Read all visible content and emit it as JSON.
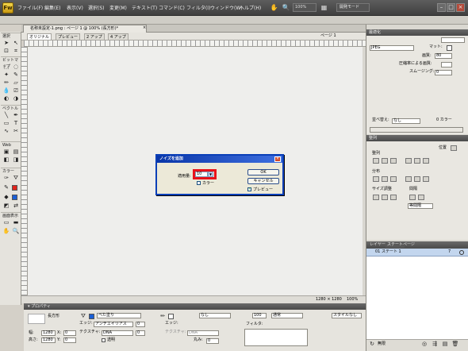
{
  "menubar": {
    "logo": "Fw",
    "items": [
      "ファイル(F)",
      "編集(E)",
      "表示(V)",
      "選択(S)",
      "変更(M)",
      "テキスト(T)",
      "コマンド(C)",
      "フィルタ(I)",
      "ウィンドウ(W)",
      "ヘルプ(H)"
    ],
    "zoom": "100%",
    "mode": "開発モード"
  },
  "document": {
    "title": "名称未設定-1.png : ページ 1 @ 100% (長方形)*",
    "views": [
      "オリジナル",
      "プレビュー",
      "2 アップ",
      "4 アップ"
    ],
    "page": "ページ 1",
    "status_size": "1280 × 1280",
    "status_zoom": "100%"
  },
  "tools": {
    "sections": [
      "選択",
      "ビットマップ",
      "ベクトル",
      "Web",
      "カラー",
      "画面表示"
    ],
    "colors": {
      "stroke": "#e2231a",
      "fill": "#1a5fd6"
    }
  },
  "dialog": {
    "title": "ノイズを追加",
    "amount_label": "適用量:",
    "amount_value": "10",
    "color_label": "カラー",
    "ok": "OK",
    "cancel": "キャンセル",
    "preview_label": "プレビュー",
    "preview_checked": true,
    "color_checked": false
  },
  "optimize": {
    "tab": "最適化",
    "format": "JPEG",
    "matte_label": "マット:",
    "quality_label": "画質:",
    "quality_value": "80",
    "selective_label": "圧縮率による画質:",
    "smoothing_label": "スムージング:",
    "smoothing_value": "0",
    "sort_label": "並べ替え:",
    "sort_value": "なし",
    "colors_label": "0 カラー"
  },
  "align": {
    "tab": "整列",
    "position": "位置",
    "align_label": "整列",
    "distribute_label": "分布",
    "size_label": "サイズ調整",
    "spacing_label": "間隔",
    "spacing_value": "等間隔"
  },
  "layers": {
    "tabs": [
      "レイヤー",
      "ステート",
      "ページ"
    ],
    "row": "01  ステート 1",
    "row_frames": "7",
    "footer_label": "無限"
  },
  "properties": {
    "header": "▾ プロパティ",
    "shape_name": "長方形",
    "fill_label": "べた塗り",
    "edge_label": "エッジ:",
    "edge_value": "アンチエイリアス",
    "edge_num": "0",
    "texture_label": "テクスチャ:",
    "texture_value": "DNA",
    "texture_num": "0",
    "transparent_label": "透明",
    "stroke_value": "なし",
    "stroke_edge_label": "エッジ:",
    "stroke_texture_label": "テクスチャ:",
    "stroke_texture_value": "DNA",
    "round_label": "丸み:",
    "round_value": "0",
    "opacity_value": "100",
    "blend_value": "通常",
    "filter_label": "フィルタ:",
    "style_value": "スタイルなし",
    "w_label": "幅:",
    "w_value": "1280",
    "x_label": "X:",
    "x_value": "0",
    "h_label": "高さ:",
    "h_value": "1280",
    "y_label": "Y:",
    "y_value": "0"
  }
}
